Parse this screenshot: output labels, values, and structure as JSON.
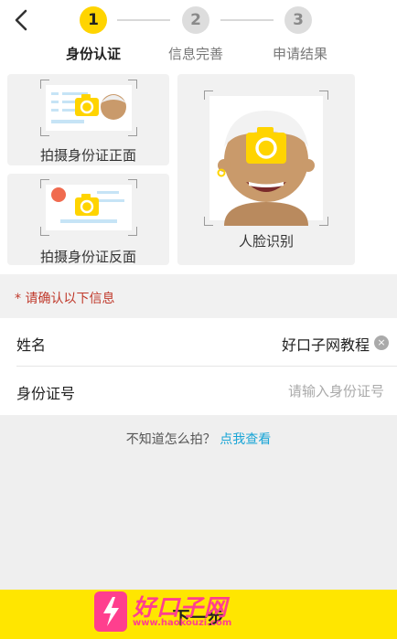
{
  "header": {
    "steps": [
      {
        "number": "1",
        "label": "身份认证",
        "active": true
      },
      {
        "number": "2",
        "label": "信息完善",
        "active": false
      },
      {
        "number": "3",
        "label": "申请结果",
        "active": false
      }
    ]
  },
  "capture": {
    "id_front_label": "拍摄身份证正面",
    "id_back_label": "拍摄身份证反面",
    "face_label": "人脸识别"
  },
  "notice": "* 请确认以下信息",
  "form": {
    "name": {
      "label": "姓名",
      "value": "好口子网教程",
      "clear_icon": "×"
    },
    "id_number": {
      "label": "身份证号",
      "placeholder": "请输入身份证号"
    }
  },
  "help": {
    "question": "不知道怎么拍？",
    "link": "点我查看"
  },
  "next_button": "下一步",
  "watermark": {
    "title": "好口子网",
    "url": "www.haokouzi.com"
  },
  "colors": {
    "accent": "#ffd400",
    "button": "#ffe600",
    "link": "#1aa5d6",
    "notice": "#c0392b"
  }
}
